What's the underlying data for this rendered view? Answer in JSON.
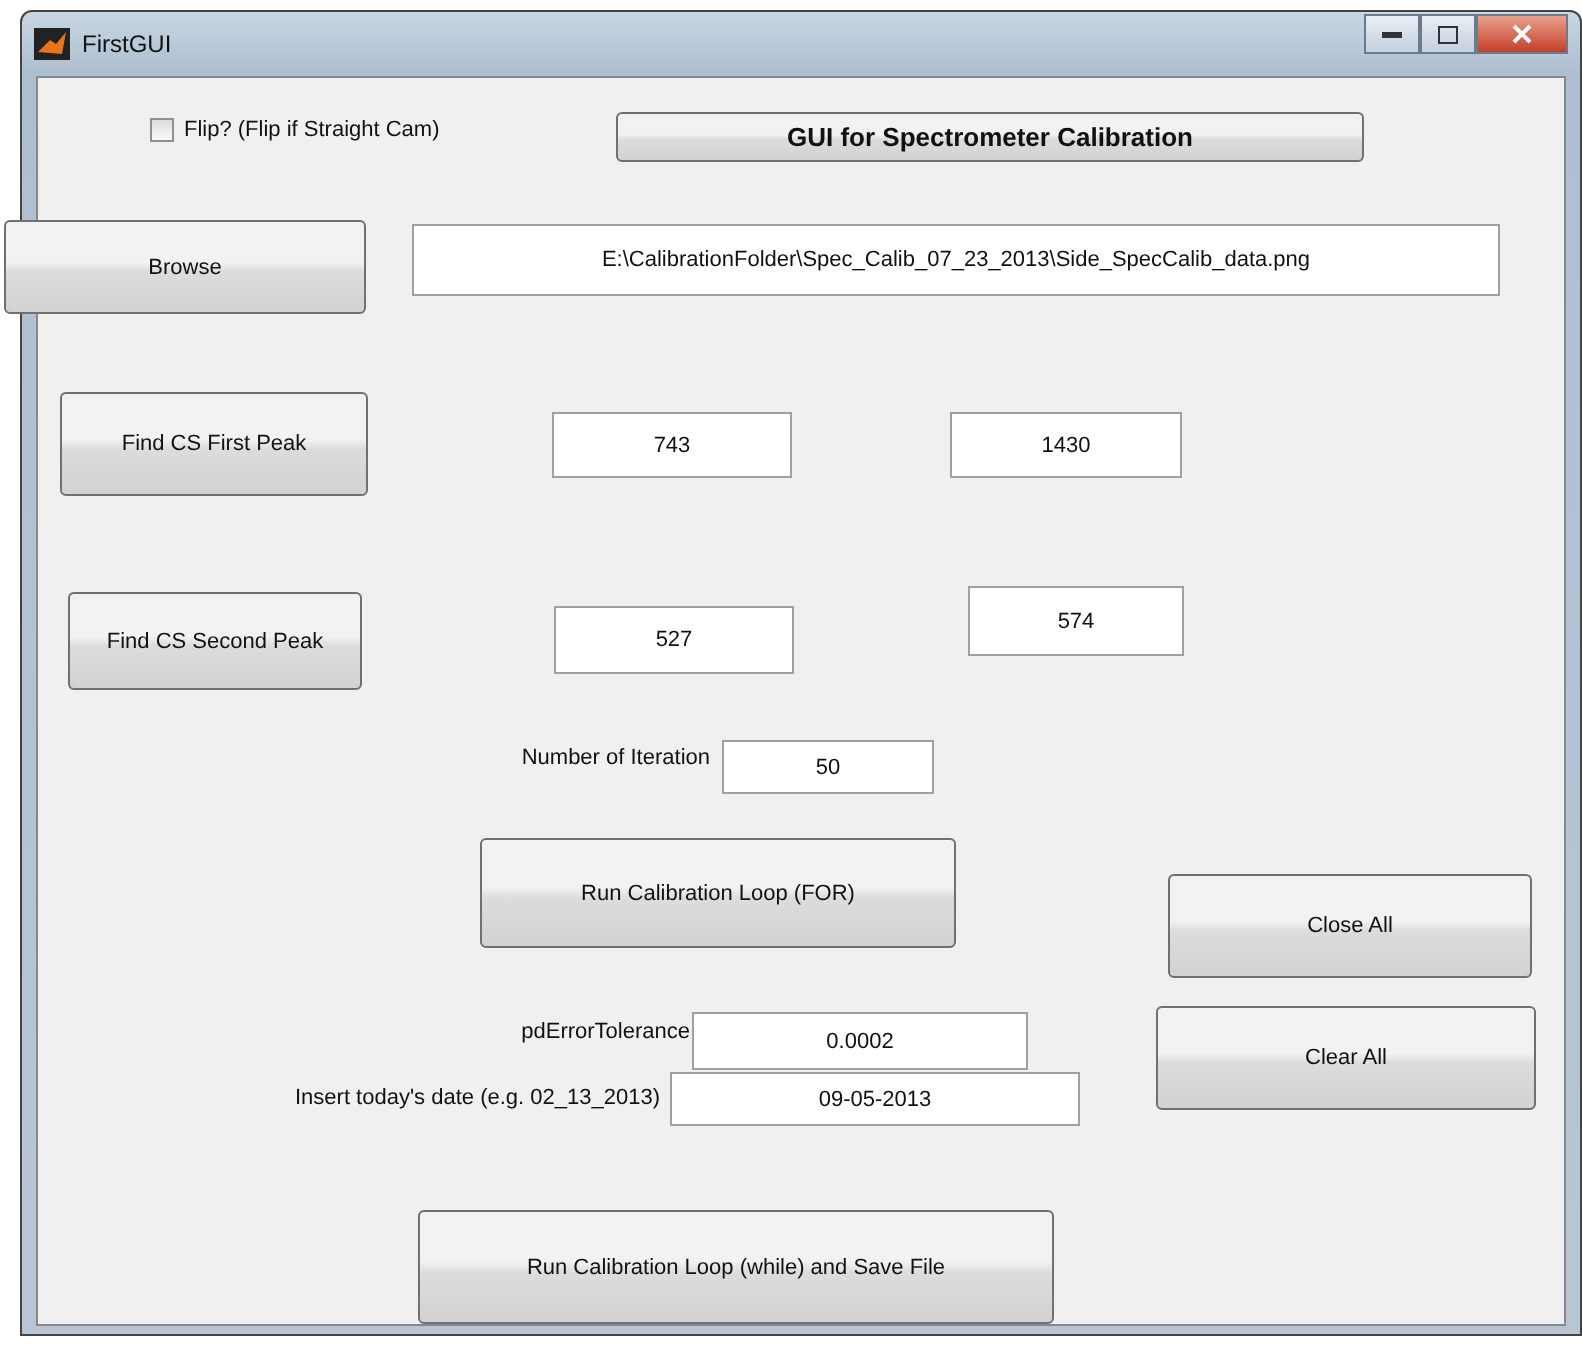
{
  "window": {
    "title": "FirstGUI"
  },
  "flip_checkbox": {
    "label": "Flip? (Flip if Straight Cam)",
    "checked": false
  },
  "controls": [
    {
      "kind": "heading",
      "text": "GUI for Spectrometer Calibration"
    },
    {
      "kind": "button",
      "text": "Browse"
    },
    {
      "kind": "field",
      "value": "E:\\CalibrationFolder\\Spec_Calib_07_23_2013\\Side_SpecCalib_data.png"
    },
    {
      "kind": "button",
      "text": "Find CS First Peak"
    },
    {
      "kind": "field",
      "value": "743"
    },
    {
      "kind": "field",
      "value": "1430"
    },
    {
      "kind": "button",
      "text": "Find CS Second Peak"
    },
    {
      "kind": "field",
      "value": "527"
    },
    {
      "kind": "field",
      "value": "574"
    },
    {
      "kind": "label",
      "text": "Number of Iteration"
    },
    {
      "kind": "field",
      "value": "50"
    },
    {
      "kind": "button",
      "text": "Run Calibration Loop (FOR)"
    },
    {
      "kind": "button",
      "text": "Close All"
    },
    {
      "kind": "label",
      "text": "pdErrorTolerance"
    },
    {
      "kind": "field",
      "value": "0.0002"
    },
    {
      "kind": "button",
      "text": "Clear All"
    },
    {
      "kind": "label",
      "text": "Insert today's date (e.g. 02_13_2013)"
    },
    {
      "kind": "field",
      "value": "09-05-2013"
    },
    {
      "kind": "button",
      "text": "Run Calibration Loop (while) and Save File"
    }
  ]
}
